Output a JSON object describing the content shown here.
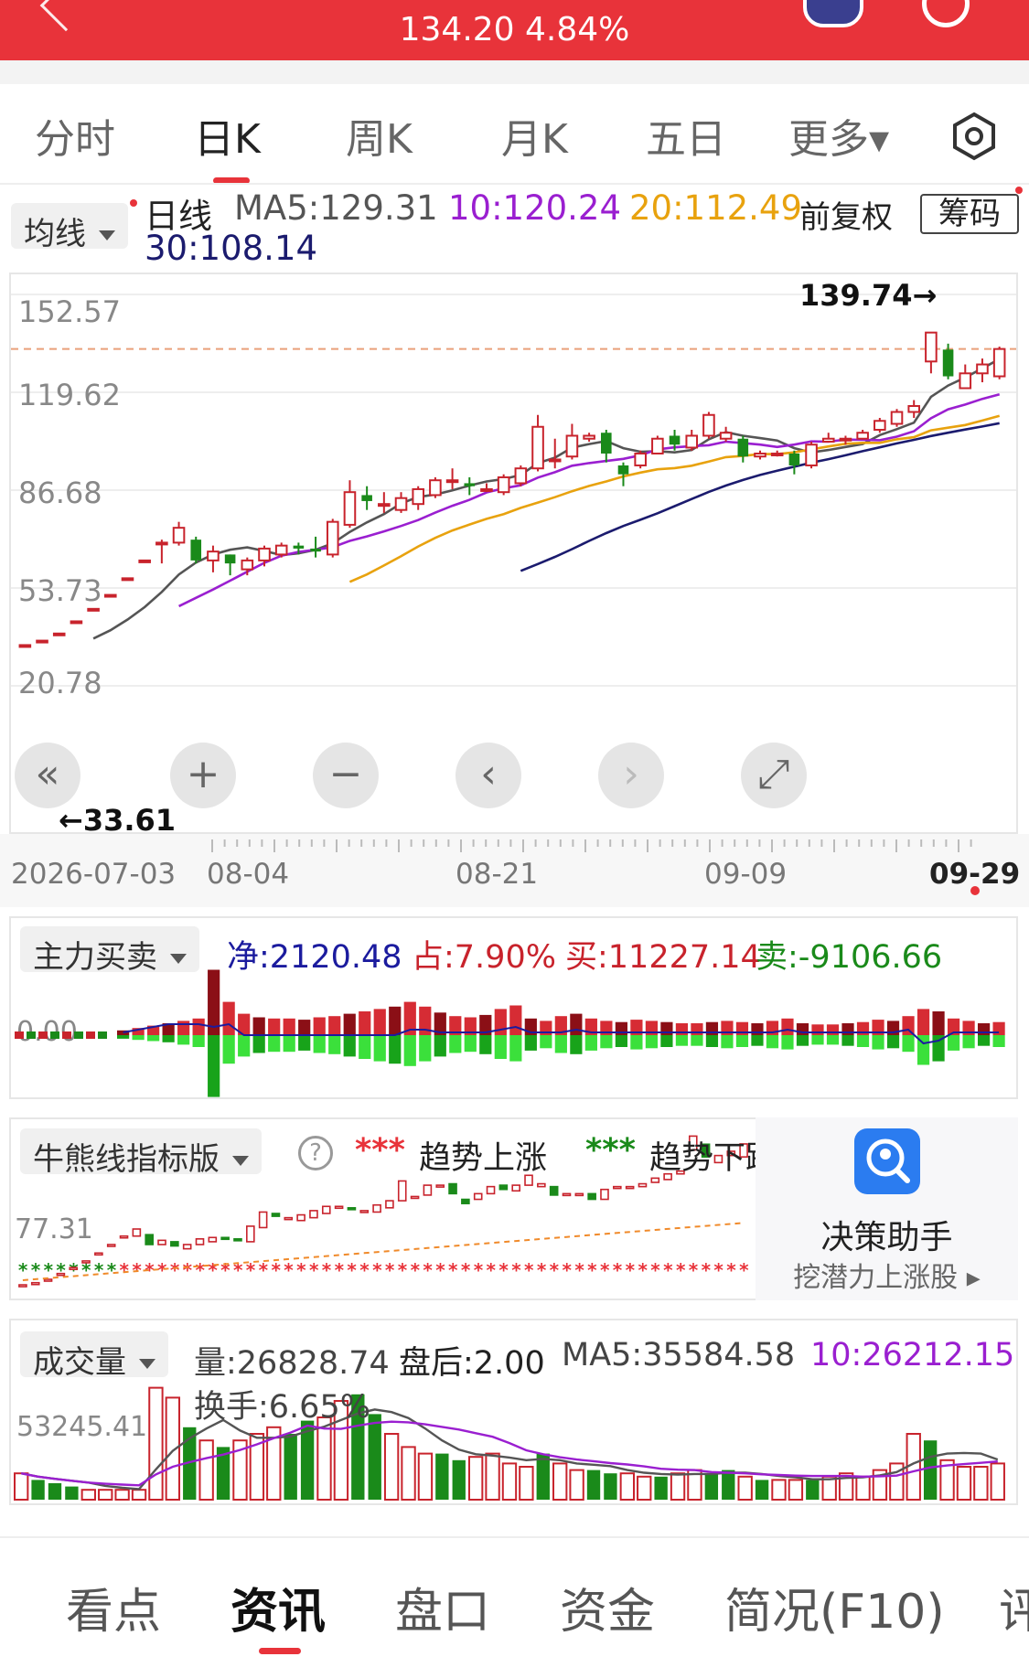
{
  "header": {
    "price_change": "134.20 4.84%",
    "icons": [
      "back-icon",
      "robot-icon",
      "search-icon"
    ]
  },
  "tabs": [
    {
      "label": "分时",
      "active": false
    },
    {
      "label": "日K",
      "active": true
    },
    {
      "label": "周K",
      "active": false
    },
    {
      "label": "月K",
      "active": false
    },
    {
      "label": "五日",
      "active": false
    },
    {
      "label": "更多▾",
      "active": false
    }
  ],
  "ma": {
    "dropdown": "均线",
    "period": "日线",
    "ma5": "MA5:129.31",
    "ma10": "10:120.24",
    "ma20": "20:112.49",
    "ma30": "30:108.14",
    "adjust": "前复权",
    "chip": "筹码"
  },
  "colors": {
    "ma5": "#555555",
    "ma10": "#9a1fd0",
    "ma20": "#e8a20e",
    "ma30": "#1b1b6e",
    "up": "#c8232c",
    "down": "#1a8a1a",
    "accent": "#e8333a"
  },
  "kline": {
    "y_labels": [
      "152.57",
      "119.62",
      "86.68",
      "53.73",
      "20.78"
    ],
    "high_label": "139.74→",
    "low_label": "←33.61",
    "x_labels": [
      "2026-07-03",
      "08-04",
      "08-21",
      "09-09",
      "09-29"
    ]
  },
  "chart_data": [
    {
      "type": "candlestick",
      "ylim": [
        20.78,
        152.57
      ],
      "y_ticks": [
        152.57,
        119.62,
        86.68,
        53.73,
        20.78
      ],
      "x_labels": [
        "2026-07-03",
        "08-04",
        "08-21",
        "09-09",
        "09-29"
      ],
      "annotations": [
        "139.74→",
        "←33.61"
      ],
      "candles": [
        {
          "o": 34.5,
          "c": 34.5,
          "h": 34.5,
          "l": 34.5
        },
        {
          "o": 36,
          "c": 36,
          "h": 36,
          "l": 36
        },
        {
          "o": 38.4,
          "c": 38.4,
          "h": 38.4,
          "l": 38.4
        },
        {
          "o": 42.5,
          "c": 42.5,
          "h": 42.5,
          "l": 42.5
        },
        {
          "o": 46.7,
          "c": 46.7,
          "h": 46.7,
          "l": 46.7
        },
        {
          "o": 51.4,
          "c": 51.4,
          "h": 51.4,
          "l": 51.4
        },
        {
          "o": 57,
          "c": 57,
          "h": 57,
          "l": 57
        },
        {
          "o": 63,
          "c": 63,
          "h": 63,
          "l": 63
        },
        {
          "o": 69,
          "c": 69,
          "h": 70,
          "l": 62
        },
        {
          "o": 69,
          "c": 74,
          "h": 76,
          "l": 68
        },
        {
          "o": 70,
          "c": 63,
          "h": 71,
          "l": 62
        },
        {
          "o": 63,
          "c": 66,
          "h": 68,
          "l": 59
        },
        {
          "o": 65,
          "c": 62,
          "h": 65,
          "l": 58
        },
        {
          "o": 60,
          "c": 63,
          "h": 64,
          "l": 58
        },
        {
          "o": 63,
          "c": 67,
          "h": 68,
          "l": 61
        },
        {
          "o": 65,
          "c": 68,
          "h": 69,
          "l": 64
        },
        {
          "o": 68,
          "c": 67,
          "h": 69,
          "l": 65
        },
        {
          "o": 67,
          "c": 66,
          "h": 71,
          "l": 64
        },
        {
          "o": 65,
          "c": 76,
          "h": 77,
          "l": 64
        },
        {
          "o": 75,
          "c": 86,
          "h": 90,
          "l": 74
        },
        {
          "o": 85,
          "c": 83,
          "h": 88,
          "l": 80
        },
        {
          "o": 82,
          "c": 82,
          "h": 86,
          "l": 79
        },
        {
          "o": 80,
          "c": 84,
          "h": 86,
          "l": 79
        },
        {
          "o": 82,
          "c": 87,
          "h": 88,
          "l": 80
        },
        {
          "o": 85,
          "c": 90,
          "h": 91,
          "l": 84
        },
        {
          "o": 90,
          "c": 90,
          "h": 94,
          "l": 87
        },
        {
          "o": 89,
          "c": 88,
          "h": 91,
          "l": 85
        },
        {
          "o": 87,
          "c": 87,
          "h": 89,
          "l": 86
        },
        {
          "o": 86,
          "c": 91,
          "h": 92,
          "l": 85
        },
        {
          "o": 89,
          "c": 94,
          "h": 95,
          "l": 88
        },
        {
          "o": 94,
          "c": 108,
          "h": 112,
          "l": 93
        },
        {
          "o": 97,
          "c": 97,
          "h": 104,
          "l": 94
        },
        {
          "o": 98,
          "c": 105,
          "h": 109,
          "l": 97
        },
        {
          "o": 104,
          "c": 105,
          "h": 106,
          "l": 103
        },
        {
          "o": 106,
          "c": 99,
          "h": 107,
          "l": 96
        },
        {
          "o": 95,
          "c": 92,
          "h": 96,
          "l": 88
        },
        {
          "o": 95,
          "c": 99,
          "h": 100,
          "l": 94
        },
        {
          "o": 99,
          "c": 104,
          "h": 105,
          "l": 99
        },
        {
          "o": 105,
          "c": 102,
          "h": 107,
          "l": 100
        },
        {
          "o": 101,
          "c": 105,
          "h": 107,
          "l": 100
        },
        {
          "o": 105,
          "c": 112,
          "h": 113,
          "l": 104
        },
        {
          "o": 104,
          "c": 106,
          "h": 108,
          "l": 103
        },
        {
          "o": 104,
          "c": 98,
          "h": 105,
          "l": 96
        },
        {
          "o": 98,
          "c": 99,
          "h": 100,
          "l": 97
        },
        {
          "o": 99,
          "c": 99,
          "h": 100,
          "l": 98
        },
        {
          "o": 99,
          "c": 95,
          "h": 100,
          "l": 92
        },
        {
          "o": 95,
          "c": 102,
          "h": 103,
          "l": 94
        },
        {
          "o": 103,
          "c": 104,
          "h": 106,
          "l": 103
        },
        {
          "o": 104,
          "c": 104,
          "h": 105,
          "l": 102
        },
        {
          "o": 104,
          "c": 106,
          "h": 107,
          "l": 104
        },
        {
          "o": 107,
          "c": 110,
          "h": 111,
          "l": 106
        },
        {
          "o": 109,
          "c": 113,
          "h": 114,
          "l": 108
        },
        {
          "o": 113,
          "c": 115,
          "h": 117,
          "l": 111
        },
        {
          "o": 130,
          "c": 139.74,
          "h": 139.74,
          "l": 126
        },
        {
          "o": 134,
          "c": 125,
          "h": 136,
          "l": 124
        },
        {
          "o": 121,
          "c": 126,
          "h": 129,
          "l": 121
        },
        {
          "o": 126,
          "c": 129,
          "h": 131,
          "l": 123
        },
        {
          "o": 125,
          "c": 134.2,
          "h": 135,
          "l": 124
        }
      ],
      "ma_series": [
        {
          "name": "MA5",
          "values": [
            null,
            null,
            null,
            null,
            36.7,
            39.5,
            43.1,
            47.3,
            52.4,
            58.3,
            62.3,
            65,
            66.6,
            67.4,
            66.2,
            64.8,
            65.4,
            66.6,
            68.8,
            72.6,
            75.8,
            78.6,
            82.2,
            84.4,
            85.2,
            86.6,
            88.2,
            89.6,
            90.4,
            91.8,
            95.8,
            97.6,
            101,
            102.2,
            103.2,
            100.8,
            99.6,
            99.8,
            99.4,
            100.2,
            103.8,
            106.2,
            105,
            104.2,
            103.4,
            100.8,
            99.4,
            100.2,
            101.2,
            102.2,
            105.2,
            107.2,
            109.4,
            118.1,
            121.9,
            124.6,
            127.7,
            130.8
          ]
        },
        {
          "name": "MA10",
          "values": [
            null,
            null,
            null,
            null,
            null,
            null,
            null,
            null,
            null,
            47.6,
            50.4,
            53.2,
            56.2,
            59.2,
            62.2,
            64.6,
            65.9,
            66.6,
            67.5,
            69.6,
            71.1,
            72.8,
            74.6,
            76.6,
            79.1,
            81.4,
            83.4,
            85.9,
            87.3,
            88.3,
            90.9,
            92.7,
            94.9,
            95.8,
            96.5,
            97.2,
            98.4,
            100.4,
            101.1,
            101.5,
            101.8,
            103,
            102.5,
            102,
            101.2,
            102,
            103.1,
            103,
            103.7,
            103.6,
            103.5,
            104.7,
            106.5,
            110.9,
            113.9,
            115.5,
            117.4,
            118.9
          ]
        },
        {
          "name": "MA20",
          "values": [
            null,
            null,
            null,
            null,
            null,
            null,
            null,
            null,
            null,
            null,
            null,
            null,
            null,
            null,
            null,
            null,
            null,
            null,
            null,
            55.8,
            58.3,
            61.3,
            64.4,
            67.7,
            70.6,
            73.1,
            75.1,
            77,
            78.6,
            80.7,
            82.5,
            84.3,
            86.3,
            88.1,
            89.6,
            91.3,
            92.6,
            93.7,
            94.1,
            94.9,
            96.3,
            97.8,
            98.2,
            98.8,
            98.8,
            99.4,
            100.4,
            101.4,
            102.3,
            102.6,
            102.6,
            103.8,
            104.5,
            106.8,
            107.7,
            108.6,
            110.1,
            111.7
          ]
        },
        {
          "name": "MA30",
          "values": [
            null,
            null,
            null,
            null,
            null,
            null,
            null,
            null,
            null,
            null,
            null,
            null,
            null,
            null,
            null,
            null,
            null,
            null,
            null,
            null,
            null,
            null,
            null,
            null,
            null,
            null,
            null,
            null,
            null,
            59.5,
            61.8,
            64.2,
            66.8,
            69.6,
            72.2,
            74.6,
            76.7,
            78.9,
            81.3,
            83.7,
            86.1,
            88.2,
            90.1,
            91.8,
            93.2,
            94.6,
            95.9,
            97.1,
            98.4,
            99.8,
            101.1,
            102.4,
            103.6,
            104.9,
            106,
            107.1,
            108.1,
            109.2
          ]
        }
      ]
    },
    {
      "type": "bar",
      "title": "主力买卖",
      "values_label": {
        "net": "净:2120.48",
        "ratio": "占:7.90%",
        "buy": "买:11227.14",
        "sell": "卖:-9106.66"
      },
      "zero_label": "0.00",
      "buy_values": [
        4,
        6,
        8,
        10,
        12,
        14,
        55,
        28,
        18,
        15,
        14,
        14,
        13,
        15,
        16,
        18,
        20,
        22,
        24,
        28,
        24,
        19,
        16,
        15,
        17,
        22,
        25,
        14,
        12,
        16,
        18,
        14,
        12,
        11,
        13,
        12,
        11,
        10,
        10,
        11,
        12,
        11,
        10,
        12,
        14,
        10,
        9,
        9,
        10,
        11,
        13,
        12,
        16,
        22,
        20,
        14,
        12,
        10,
        11
      ],
      "sell_values": [
        -3,
        -4,
        -5,
        -6,
        -8,
        -10,
        -52,
        -24,
        -18,
        -15,
        -14,
        -14,
        -13,
        -15,
        -16,
        -18,
        -20,
        -22,
        -24,
        -26,
        -22,
        -18,
        -15,
        -14,
        -16,
        -20,
        -22,
        -13,
        -11,
        -15,
        -16,
        -13,
        -11,
        -10,
        -12,
        -11,
        -10,
        -9,
        -9,
        -10,
        -11,
        -10,
        -9,
        -11,
        -12,
        -9,
        -8,
        -8,
        -9,
        -10,
        -12,
        -11,
        -14,
        -25,
        -22,
        -13,
        -11,
        -9,
        -10
      ]
    },
    {
      "type": "indicator",
      "title": "牛熊线指标版",
      "legend": [
        {
          "symbol": "***",
          "label": "趋势上涨",
          "color": "#e8333a"
        },
        {
          "symbol": "***",
          "label": "趋势下跌",
          "color": "#1a8a1a"
        }
      ],
      "y_label": "77.31"
    },
    {
      "type": "bar",
      "title": "成交量",
      "labels": {
        "vol": "量:26828.74",
        "after": "盘后:2.00",
        "ma5": "MA5:35584.58",
        "ma10": "10:26212.15",
        "turnover": "换手:6.65%"
      },
      "y_label": "53245.41",
      "values": [
        8,
        6,
        5,
        4,
        3,
        3,
        3,
        3,
        34,
        31,
        22,
        18,
        16,
        18,
        20,
        22,
        20,
        24,
        25,
        30,
        32,
        26,
        20,
        16,
        14,
        14,
        12,
        13,
        14,
        11,
        10,
        14,
        11,
        9,
        9,
        8,
        8,
        7,
        7,
        8,
        9,
        8,
        9,
        7,
        6,
        6,
        6,
        6,
        7,
        8,
        7,
        9,
        11,
        20,
        18,
        12,
        10,
        10,
        11
      ],
      "up": [
        1,
        0,
        0,
        0,
        1,
        1,
        1,
        1,
        1,
        1,
        0,
        1,
        0,
        1,
        1,
        1,
        0,
        0,
        1,
        1,
        0,
        0,
        1,
        1,
        1,
        0,
        0,
        1,
        1,
        1,
        1,
        0,
        1,
        1,
        0,
        0,
        1,
        1,
        0,
        1,
        1,
        0,
        0,
        1,
        0,
        1,
        1,
        0,
        1,
        1,
        1,
        1,
        1,
        1,
        0,
        1,
        1,
        1,
        1
      ]
    }
  ],
  "sub_indicators": {
    "bull_bear_dropdown": "牛熊线指标版",
    "help": "?",
    "up_symbol": "***",
    "up_label": "趋势上涨",
    "down_symbol": "***",
    "down_label": "趋势下跌",
    "y_label": "77.31"
  },
  "assistant": {
    "title": "决策助手",
    "subtitle": "挖潜力上涨股 ▸"
  },
  "volume": {
    "dropdown": "成交量",
    "vol": "量:26828.74",
    "after": "盘后:2.00",
    "ma5": "MA5:35584.58",
    "ma10": "10:26212.15",
    "turnover": "换手:6.65%",
    "y_label": "53245.41"
  },
  "capital": {
    "dropdown": "主力买卖",
    "net": "净:2120.48",
    "ratio": "占:7.90%",
    "buy": "买:11227.14",
    "sell": "卖:-9106.66",
    "zero": "0.00"
  },
  "bottom_tabs": [
    {
      "label": "看点",
      "active": false
    },
    {
      "label": "资讯",
      "active": true
    },
    {
      "label": "盘口",
      "active": false
    },
    {
      "label": "资金",
      "active": false
    },
    {
      "label": "简况(F10)",
      "active": false
    },
    {
      "label": "评",
      "active": false
    }
  ],
  "controls": [
    "«",
    "+",
    "−",
    "‹",
    "›",
    "⤢"
  ]
}
